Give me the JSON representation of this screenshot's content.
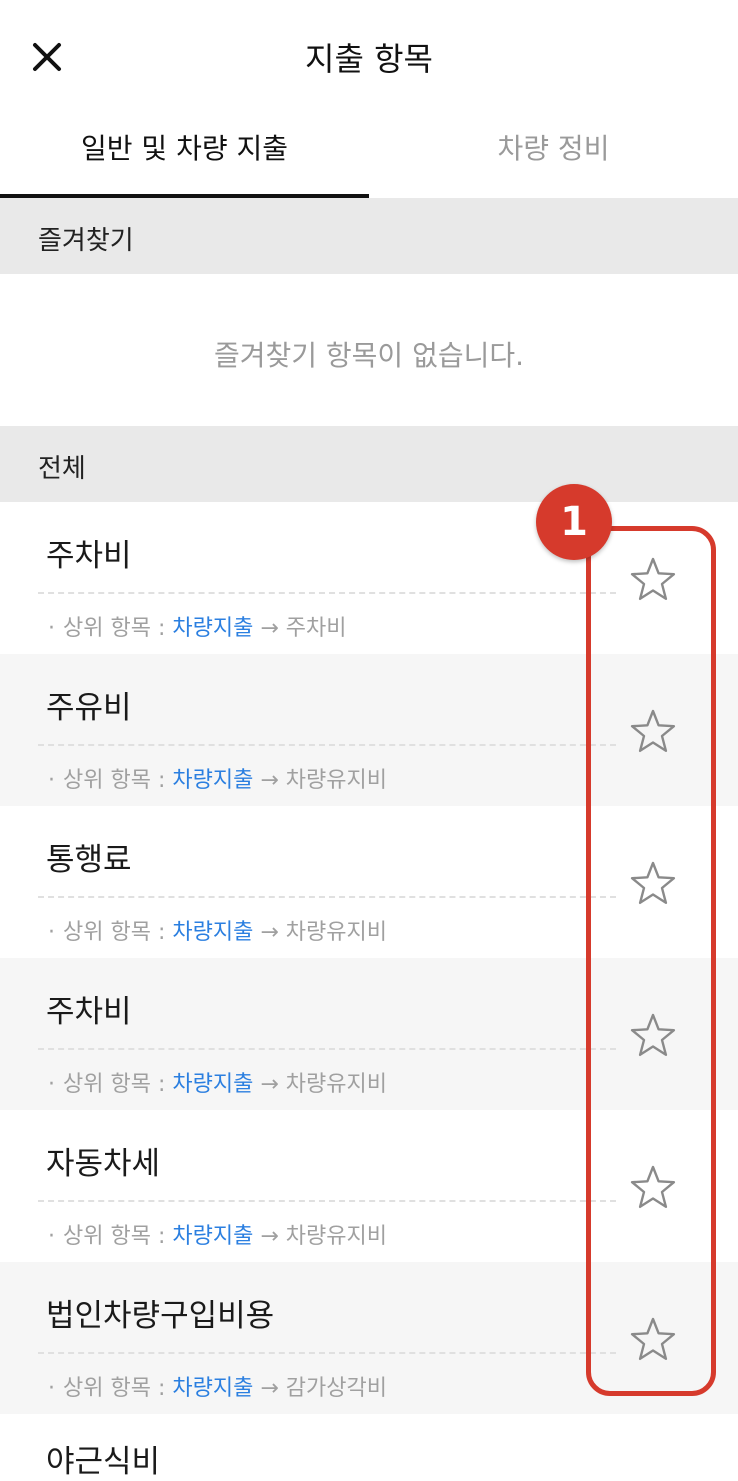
{
  "header": {
    "title": "지출 항목",
    "close_icon": "close-icon"
  },
  "tabs": [
    {
      "label": "일반 및 차량 지출",
      "active": true
    },
    {
      "label": "차량 정비",
      "active": false
    }
  ],
  "favorites": {
    "section_label": "즐겨찾기",
    "empty_text": "즐겨찾기 항목이 없습니다."
  },
  "all": {
    "section_label": "전체"
  },
  "items": [
    {
      "name": "주차비",
      "parent_prefix": "상위 항목 :",
      "parent_link": "차량지출",
      "arrow": "→",
      "parent_child": "주차비"
    },
    {
      "name": "주유비",
      "parent_prefix": "상위 항목 :",
      "parent_link": "차량지출",
      "arrow": "→",
      "parent_child": "차량유지비"
    },
    {
      "name": "통행료",
      "parent_prefix": "상위 항목 :",
      "parent_link": "차량지출",
      "arrow": "→",
      "parent_child": "차량유지비"
    },
    {
      "name": "주차비",
      "parent_prefix": "상위 항목 :",
      "parent_link": "차량지출",
      "arrow": "→",
      "parent_child": "차량유지비"
    },
    {
      "name": "자동차세",
      "parent_prefix": "상위 항목 :",
      "parent_link": "차량지출",
      "arrow": "→",
      "parent_child": "차량유지비"
    },
    {
      "name": "법인차량구입비용",
      "parent_prefix": "상위 항목 :",
      "parent_link": "차량지출",
      "arrow": "→",
      "parent_child": "감가상각비"
    }
  ],
  "partial_item": {
    "name": "야근식비"
  },
  "annotation": {
    "badge": "1",
    "color": "#d63a2c"
  },
  "colors": {
    "link": "#2b7fe0",
    "section_bg": "#e9e9e9",
    "alt_row_bg": "#f6f6f6"
  }
}
